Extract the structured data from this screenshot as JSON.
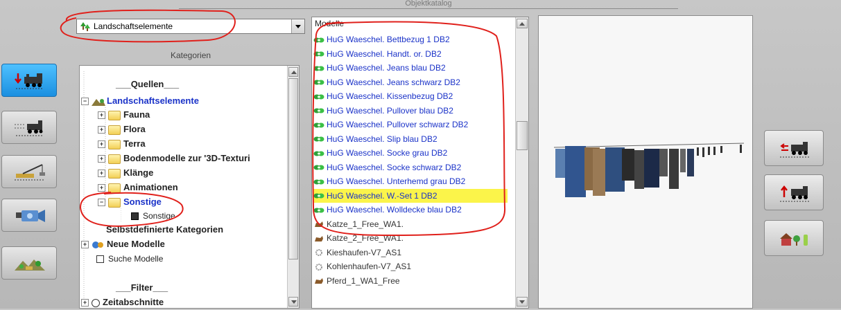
{
  "window": {
    "title": "Objektkatalog"
  },
  "category_select": {
    "value": "Landschaftselemente"
  },
  "categories_label": "Kategorien",
  "tree": {
    "items": [
      {
        "label": "___Quellen___"
      },
      {
        "label": "Landschaftselemente"
      },
      {
        "label": "Fauna"
      },
      {
        "label": "Flora"
      },
      {
        "label": "Terra"
      },
      {
        "label": "Bodenmodelle zur '3D-Texturi"
      },
      {
        "label": "Klänge"
      },
      {
        "label": "Animationen"
      },
      {
        "label": "Sonstige"
      },
      {
        "label": "Sonstige"
      },
      {
        "label": "Selbstdefinierte Kategorien"
      },
      {
        "label": "Neue Modelle"
      },
      {
        "label": "Suche Modelle"
      },
      {
        "label": "___Filter___"
      },
      {
        "label": "Zeitabschnitte"
      }
    ]
  },
  "models": {
    "header": "Modelle",
    "items": [
      {
        "label": "HuG Waeschel. Bettbezug 1 DB2"
      },
      {
        "label": "HuG Waeschel. Handt. or. DB2"
      },
      {
        "label": "HuG Waeschel. Jeans blau DB2"
      },
      {
        "label": "HuG Waeschel. Jeans schwarz DB2"
      },
      {
        "label": "HuG Waeschel. Kissenbezug DB2"
      },
      {
        "label": "HuG Waeschel. Pullover blau DB2"
      },
      {
        "label": "HuG Waeschel. Pullover schwarz DB2"
      },
      {
        "label": "HuG Waeschel. Slip blau DB2"
      },
      {
        "label": "HuG Waeschel. Socke grau DB2"
      },
      {
        "label": "HuG Waeschel. Socke schwarz DB2"
      },
      {
        "label": "HuG Waeschel. Unterhemd grau DB2"
      },
      {
        "label": "HuG Waeschel. W.-Set 1 DB2",
        "selected": true
      },
      {
        "label": "HuG Waeschel. Wolldecke blau DB2"
      },
      {
        "label": "Katze_1_Free_WA1."
      },
      {
        "label": "Katze_2_Free_WA1."
      },
      {
        "label": "Kieshaufen-V7_AS1"
      },
      {
        "label": "Kohlenhaufen-V7_AS1"
      },
      {
        "label": "Pferd_1_WA1_Free"
      }
    ]
  },
  "colors": {
    "link_blue": "#1a32c8",
    "selection_yellow": "#fbf44a",
    "annotation_red": "#e0201b",
    "active_button": "#2aa3f0"
  }
}
